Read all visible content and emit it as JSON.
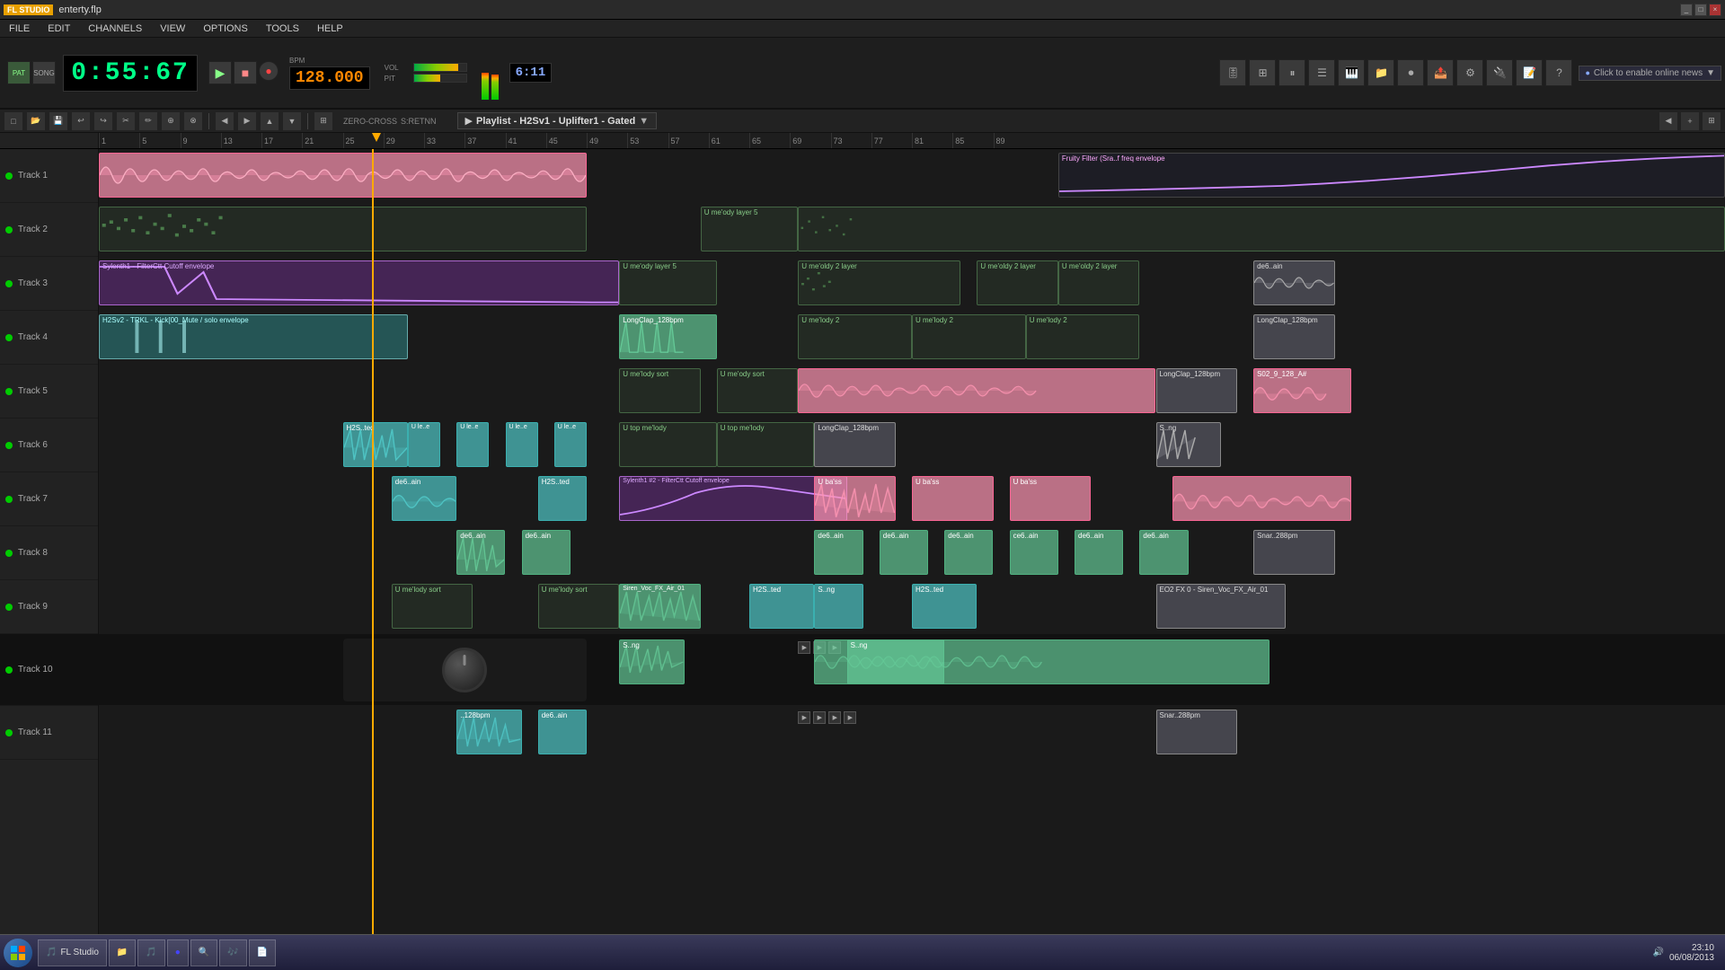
{
  "titlebar": {
    "logo": "FL",
    "filename": "enterty.flp",
    "buttons": [
      "_",
      "□",
      "×"
    ]
  },
  "menubar": {
    "items": [
      "FILE",
      "EDIT",
      "CHANNELS",
      "VIEW",
      "OPTIONS",
      "TOOLS",
      "HELP"
    ]
  },
  "transport": {
    "time_display": "0:55:67",
    "bpm": "128.000",
    "info_display": "6:11",
    "play_icon": "▶",
    "stop_icon": "■",
    "record_icon": "●",
    "pattern_mode": "PAT",
    "song_mode": "SONG"
  },
  "playlist": {
    "title": "Playlist - H2Sv1 - Uplifter1 - Gated"
  },
  "toolbar2": {
    "buttons": [
      "✂",
      "✏",
      "⊕",
      "⊗",
      "↩",
      "↪",
      "◀",
      "▶",
      "▲",
      "▼",
      "◈",
      "⊞"
    ]
  },
  "tracks": [
    {
      "label": "Track 1",
      "clips": [
        {
          "label": "",
          "color": "pink",
          "start_pct": 0,
          "width_pct": 30,
          "type": "waveform_pink"
        },
        {
          "label": "Fruity Filter (Sra..f freq envelope",
          "color": "line",
          "start_pct": 60,
          "width_pct": 40,
          "type": "automation"
        }
      ]
    },
    {
      "label": "Track 2",
      "clips": [
        {
          "label": "",
          "color": "dotted",
          "start_pct": 0,
          "width_pct": 30,
          "type": "midi_dark"
        },
        {
          "label": "U me'ody layer 5",
          "color": "dotted",
          "start_pct": 37,
          "width_pct": 6,
          "type": "midi_dark"
        },
        {
          "label": "",
          "color": "dotted",
          "start_pct": 43,
          "width_pct": 58,
          "type": "midi_dark"
        }
      ]
    },
    {
      "label": "Track 3",
      "clips": [
        {
          "label": "Sylenth1 - FilterCtt Cutoff envelope",
          "color": "purple",
          "start_pct": 0,
          "width_pct": 32,
          "type": "automation_purple"
        },
        {
          "label": "U me'ody layer 5",
          "color": "dotted",
          "start_pct": 32,
          "width_pct": 6,
          "type": "midi_dark"
        },
        {
          "label": "U me'oldy 2 layer",
          "color": "dotted",
          "start_pct": 43,
          "width_pct": 16,
          "type": "midi_dark"
        },
        {
          "label": "U me'oldy 2 layer",
          "color": "dotted",
          "start_pct": 59,
          "width_pct": 7,
          "type": "midi_dark"
        },
        {
          "label": "de6..ain",
          "color": "gray",
          "start_pct": 72,
          "width_pct": 5,
          "type": "label_only"
        }
      ]
    },
    {
      "label": "Track 4",
      "clips": [
        {
          "label": "H2Sv2 - TRKL - Kick[00_Mute / solo envelope",
          "color": "teal",
          "start_pct": 0,
          "width_pct": 20,
          "type": "automation_teal"
        },
        {
          "label": "LongClap_128bpm",
          "color": "green",
          "start_pct": 32,
          "width_pct": 6,
          "type": "waveform_green"
        },
        {
          "label": "U me'lody 2",
          "color": "dotted",
          "start_pct": 43,
          "width_pct": 7,
          "type": "midi_dark"
        },
        {
          "label": "LongClap_128bpm",
          "color": "gray",
          "start_pct": 72,
          "width_pct": 5,
          "type": "label_only"
        }
      ]
    },
    {
      "label": "Track 5",
      "clips": [
        {
          "label": "U me'lody sort",
          "color": "dotted",
          "start_pct": 32,
          "width_pct": 6,
          "type": "midi_dark"
        },
        {
          "label": "U me'ody sort",
          "color": "dotted",
          "start_pct": 39,
          "width_pct": 6,
          "type": "midi_dark"
        },
        {
          "label": "",
          "color": "pink",
          "start_pct": 43,
          "width_pct": 22,
          "type": "waveform_pink"
        },
        {
          "label": "LongClap_128bpm",
          "color": "gray",
          "start_pct": 65,
          "width_pct": 5,
          "type": "label_only"
        },
        {
          "label": "S02_9_128_A#",
          "color": "gray",
          "start_pct": 72,
          "width_pct": 5,
          "type": "label_only"
        }
      ]
    },
    {
      "label": "Track 6",
      "clips": [
        {
          "label": "H2S..ted",
          "color": "teal",
          "start_pct": 15,
          "width_pct": 5,
          "type": "waveform_teal"
        },
        {
          "label": "U le..e",
          "color": "teal",
          "start_pct": 20,
          "width_pct": 4,
          "type": "small"
        },
        {
          "label": "U le..e",
          "color": "teal",
          "start_pct": 24,
          "width_pct": 4,
          "type": "small"
        },
        {
          "label": "U le..e",
          "color": "teal",
          "start_pct": 28,
          "width_pct": 4,
          "type": "small"
        },
        {
          "label": "U top me'lody",
          "color": "dotted",
          "start_pct": 32,
          "width_pct": 6,
          "type": "midi_dark"
        },
        {
          "label": "LongClap_128bpm",
          "color": "gray",
          "start_pct": 44,
          "width_pct": 5,
          "type": "label_only"
        },
        {
          "label": "S..ng",
          "color": "gray",
          "start_pct": 65,
          "width_pct": 4,
          "type": "label_only"
        }
      ]
    },
    {
      "label": "Track 7",
      "clips": [
        {
          "label": "de6..ain",
          "color": "teal",
          "start_pct": 18,
          "width_pct": 4,
          "type": "waveform_teal"
        },
        {
          "label": "H2S..ted",
          "color": "teal",
          "start_pct": 27,
          "width_pct": 5,
          "type": "small"
        },
        {
          "label": "Sylenth1 #2 - FilterCtt Cutoff envelope",
          "color": "purple",
          "start_pct": 32,
          "width_pct": 14,
          "type": "automation_purple"
        },
        {
          "label": "U ba'ss",
          "color": "pink",
          "start_pct": 44,
          "width_pct": 5,
          "type": "waveform_pink_sm"
        },
        {
          "label": "U ba'ss",
          "color": "pink",
          "start_pct": 50,
          "width_pct": 5,
          "type": "waveform_pink_sm"
        }
      ]
    },
    {
      "label": "Track 8",
      "clips": [
        {
          "label": "de6..ain",
          "color": "green",
          "start_pct": 22,
          "width_pct": 4,
          "type": "waveform_green_sm"
        },
        {
          "label": "de6..ain",
          "color": "green",
          "start_pct": 27,
          "width_pct": 4,
          "type": "waveform_green_sm"
        },
        {
          "label": "de6..ain",
          "color": "green",
          "start_pct": 44,
          "width_pct": 4,
          "type": "waveform_green_sm"
        },
        {
          "label": "de6..ain",
          "color": "green",
          "start_pct": 49,
          "width_pct": 4,
          "type": "waveform_green_sm"
        },
        {
          "label": "Snar..288pm",
          "color": "gray",
          "start_pct": 72,
          "width_pct": 5,
          "type": "label_only"
        }
      ]
    },
    {
      "label": "Track 9",
      "clips": [
        {
          "label": "U me'lody sort",
          "color": "dotted",
          "start_pct": 18,
          "width_pct": 5,
          "type": "midi_dark"
        },
        {
          "label": "U me'lody sort",
          "color": "dotted",
          "start_pct": 27,
          "width_pct": 5,
          "type": "midi_dark"
        },
        {
          "label": "Siren_Voc_FX_Air_01",
          "color": "green",
          "start_pct": 32,
          "width_pct": 6,
          "type": "waveform_green_sm"
        },
        {
          "label": "H2S..ted",
          "color": "teal",
          "start_pct": 40,
          "width_pct": 4,
          "type": "small"
        },
        {
          "label": "S..ng",
          "color": "teal",
          "start_pct": 45,
          "width_pct": 4,
          "type": "small"
        },
        {
          "label": "EO2 FX 0",
          "color": "gray",
          "start_pct": 65,
          "width_pct": 5,
          "type": "label_only"
        }
      ]
    },
    {
      "label": "Track 10",
      "clips": [
        {
          "label": "S..ng",
          "color": "green",
          "start_pct": 32,
          "width_pct": 5,
          "type": "waveform_green_sm"
        },
        {
          "label": "",
          "color": "green",
          "start_pct": 44,
          "width_pct": 20,
          "type": "waveform_green"
        }
      ]
    },
    {
      "label": "Track 11",
      "clips": [
        {
          "label": "..128bpm",
          "color": "teal",
          "start_pct": 22,
          "width_pct": 5,
          "type": "waveform_teal"
        },
        {
          "label": "de6..ain",
          "color": "teal",
          "start_pct": 27,
          "width_pct": 4,
          "type": "small"
        },
        {
          "label": "Snar..288pm",
          "color": "gray",
          "start_pct": 65,
          "width_pct": 5,
          "type": "label_only"
        }
      ]
    }
  ],
  "taskbar": {
    "start_icon": "⊞",
    "items": [
      {
        "label": "FL Studio",
        "icon": "🎵"
      },
      {
        "label": "File Manager",
        "icon": "📁"
      },
      {
        "label": "Media",
        "icon": "🎵"
      },
      {
        "label": "Chrome",
        "icon": "●"
      },
      {
        "label": "Search",
        "icon": "🔍"
      },
      {
        "label": "WinAmp",
        "icon": "🎶"
      },
      {
        "label": "App",
        "icon": "📄"
      }
    ],
    "time": "23:10",
    "date": "06/08/2013"
  },
  "colors": {
    "accent": "#ffaa00",
    "led_green": "#00cc00",
    "bg_dark": "#1a1a1a",
    "bg_medium": "#252525",
    "track_pink": "#ff96b4",
    "track_green": "#64c896",
    "track_teal": "#50c8c8",
    "track_purple": "#b464c8"
  }
}
